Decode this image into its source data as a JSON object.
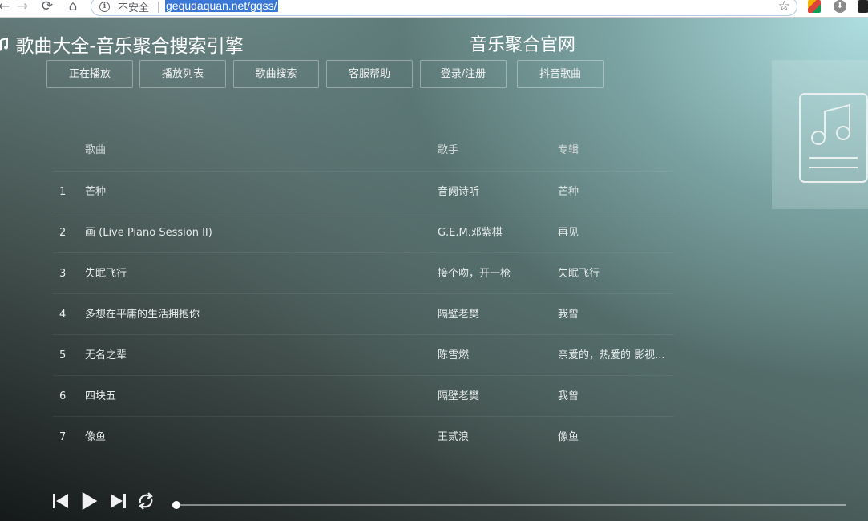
{
  "browser": {
    "insecure_label": "不安全",
    "url": "gequdaquan.net/gqss/"
  },
  "header": {
    "site_title": "歌曲大全-音乐聚合搜索引擎",
    "site_subtitle": "音乐聚合官网"
  },
  "nav": {
    "tabs": [
      {
        "label": "正在播放"
      },
      {
        "label": "播放列表"
      },
      {
        "label": "歌曲搜索"
      },
      {
        "label": "客服帮助"
      },
      {
        "label": "登录/注册"
      },
      {
        "label": "抖音歌曲"
      }
    ]
  },
  "table": {
    "headers": {
      "song": "歌曲",
      "artist": "歌手",
      "album": "专辑"
    },
    "rows": [
      {
        "num": "1",
        "song": "芒种",
        "artist": "音阙诗听",
        "album": "芒种"
      },
      {
        "num": "2",
        "song": "画 (Live Piano Session II)",
        "artist": "G.E.M.邓紫棋",
        "album": "再见"
      },
      {
        "num": "3",
        "song": "失眠飞行",
        "artist": "接个吻，开一枪",
        "album": "失眠飞行"
      },
      {
        "num": "4",
        "song": "多想在平庸的生活拥抱你",
        "artist": "隔壁老樊",
        "album": "我曾"
      },
      {
        "num": "5",
        "song": "无名之辈",
        "artist": "陈雪燃",
        "album": "亲爱的，热爱的 影视..."
      },
      {
        "num": "6",
        "song": "四块五",
        "artist": "隔壁老樊",
        "album": "我曾"
      },
      {
        "num": "7",
        "song": "像鱼",
        "artist": "王贰浪",
        "album": "像鱼"
      }
    ]
  },
  "player": {
    "progress": 0.0
  },
  "colors": {
    "url_highlight": "#3a78d8",
    "text": "#e6eceb"
  }
}
